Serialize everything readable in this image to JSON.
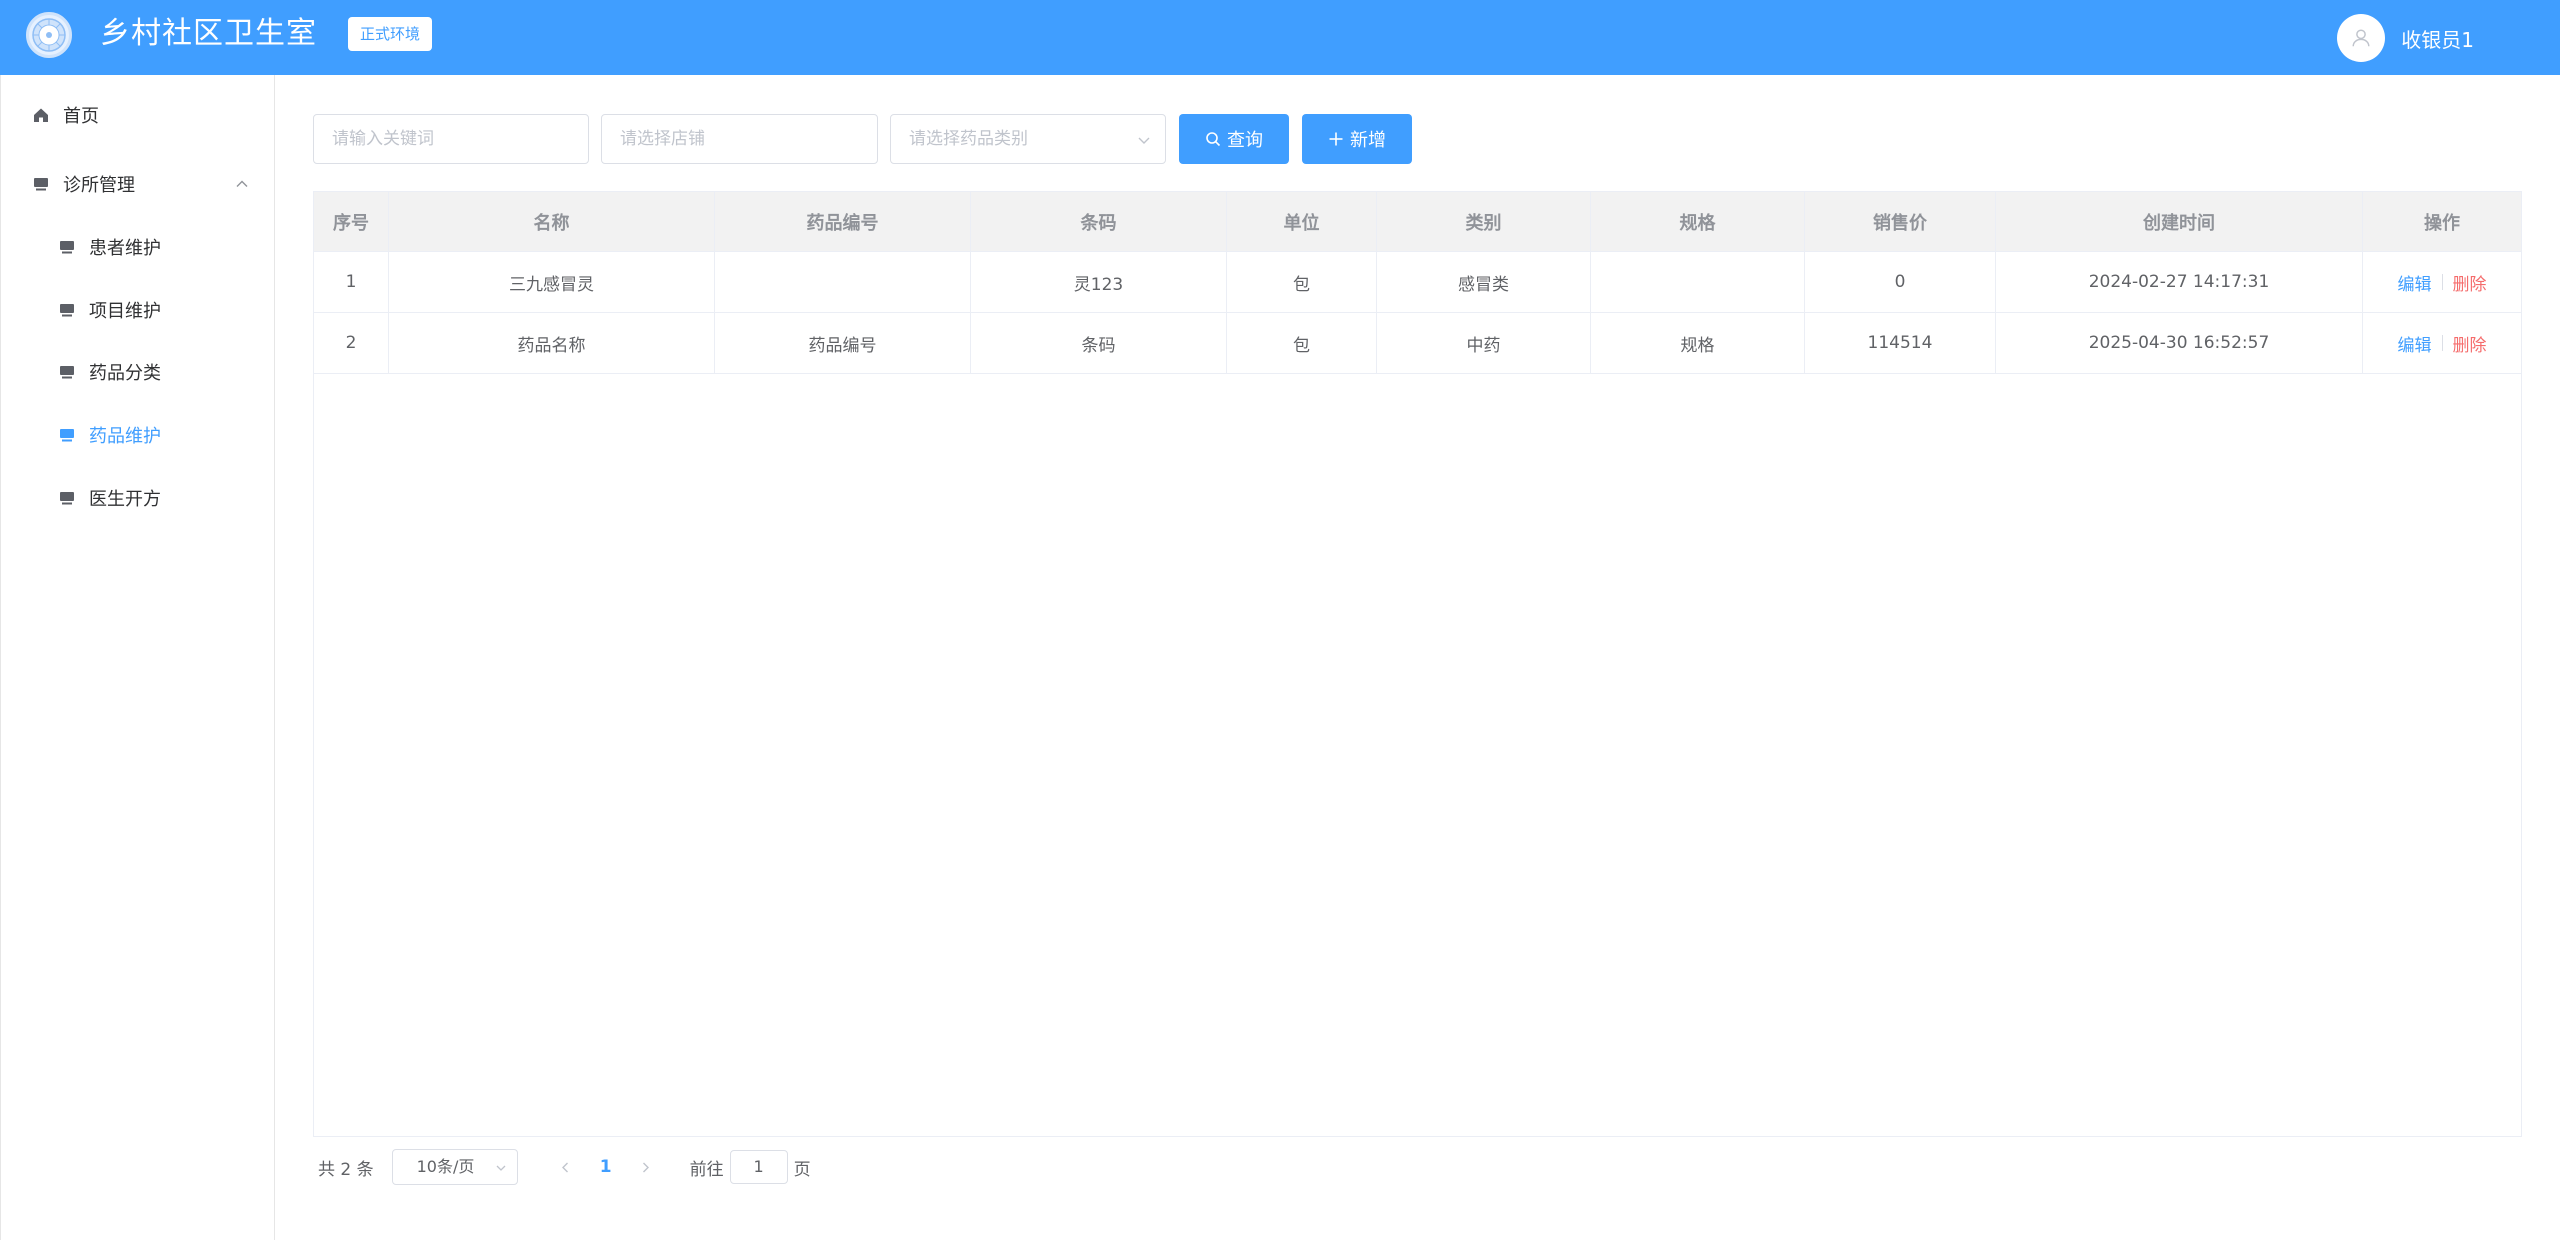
{
  "header": {
    "title": "乡村社区卫生室",
    "env_badge": "正式环境",
    "user_name": "收银员1",
    "brand_color": "#409eff"
  },
  "sidebar": {
    "items": [
      {
        "label": "首页",
        "icon": "home-icon"
      },
      {
        "label": "诊所管理",
        "icon": "monitor-icon",
        "expanded": true
      },
      {
        "label": "患者维护",
        "icon": "monitor-icon"
      },
      {
        "label": "项目维护",
        "icon": "monitor-icon"
      },
      {
        "label": "药品分类",
        "icon": "monitor-icon"
      },
      {
        "label": "药品维护",
        "icon": "monitor-icon",
        "active": true
      },
      {
        "label": "医生开方",
        "icon": "monitor-icon"
      }
    ]
  },
  "toolbar": {
    "keyword_placeholder": "请输入关键词",
    "store_placeholder": "请选择店铺",
    "category_placeholder": "请选择药品类别",
    "query_label": "查询",
    "add_label": "新增"
  },
  "table": {
    "headers": [
      "序号",
      "名称",
      "药品编号",
      "条码",
      "单位",
      "类别",
      "规格",
      "销售价",
      "创建时间",
      "操作"
    ],
    "rows": [
      [
        "1",
        "三九感冒灵",
        "",
        "灵123",
        "包",
        "感冒类",
        "",
        "0",
        "2024-02-27 14:17:31"
      ],
      [
        "2",
        "药品名称",
        "药品编号",
        "条码",
        "包",
        "中药",
        "规格",
        "114514",
        "2025-04-30 16:52:57"
      ]
    ],
    "edit_label": "编辑",
    "delete_label": "删除"
  },
  "pagination": {
    "total_text": "共 2 条",
    "page_size": "10条/页",
    "current_page": "1",
    "goto_label": "前往",
    "goto_value": "1",
    "page_suffix": "页"
  }
}
